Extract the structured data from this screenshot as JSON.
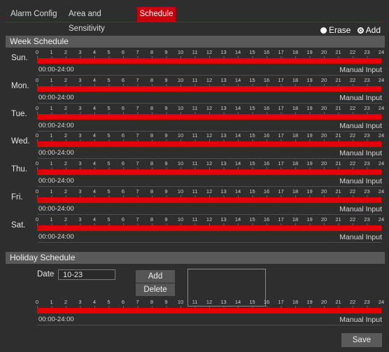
{
  "tabs": [
    {
      "label": "Alarm Config",
      "active": false
    },
    {
      "label": "Area and Sensitivity",
      "active": false
    },
    {
      "label": "Schedule",
      "active": true
    }
  ],
  "mode": {
    "erase_label": "Erase",
    "add_label": "Add",
    "selected": "Add"
  },
  "week_schedule": {
    "title": "Week Schedule",
    "tick_labels": [
      "0",
      "1",
      "2",
      "3",
      "4",
      "5",
      "6",
      "7",
      "8",
      "9",
      "10",
      "11",
      "12",
      "13",
      "14",
      "15",
      "16",
      "17",
      "18",
      "19",
      "20",
      "21",
      "22",
      "23",
      "24"
    ],
    "manual_input_label": "Manual Input",
    "days": [
      {
        "label": "Sun.",
        "range": "00:00-24:00"
      },
      {
        "label": "Mon.",
        "range": "00:00-24:00"
      },
      {
        "label": "Tue.",
        "range": "00:00-24:00"
      },
      {
        "label": "Wed.",
        "range": "00:00-24:00"
      },
      {
        "label": "Thu.",
        "range": "00:00-24:00"
      },
      {
        "label": "Fri.",
        "range": "00:00-24:00"
      },
      {
        "label": "Sat.",
        "range": "00:00-24:00"
      }
    ]
  },
  "holiday_schedule": {
    "title": "Holiday Schedule",
    "date_label": "Date",
    "date_value": "10-23",
    "add_label": "Add",
    "delete_label": "Delete",
    "range": "00:00-24:00",
    "manual_input_label": "Manual Input"
  },
  "save_label": "Save",
  "colors": {
    "accent": "#c8000b",
    "bar": "#e60000",
    "header": "#595959",
    "background": "#2e2e2e"
  }
}
